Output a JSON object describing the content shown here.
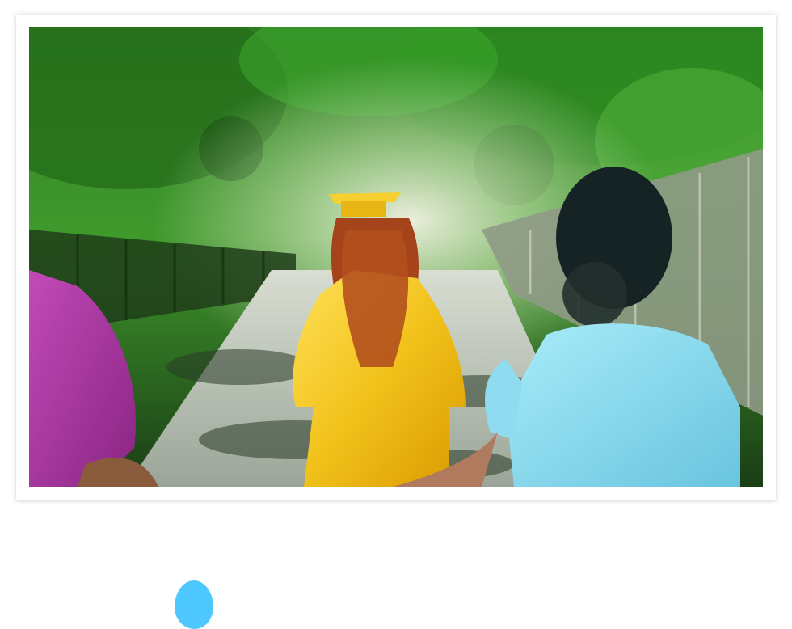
{
  "photo": {
    "subject": "graduation-walk-photo"
  },
  "colors": {
    "foliage": "#1f7a1a",
    "gown": "#f2c21b",
    "blouse": "#8fdcf0",
    "left_shirt": "#b23aa6",
    "path": "#cfd6c8",
    "accent_dot": "#4fc7ff"
  }
}
